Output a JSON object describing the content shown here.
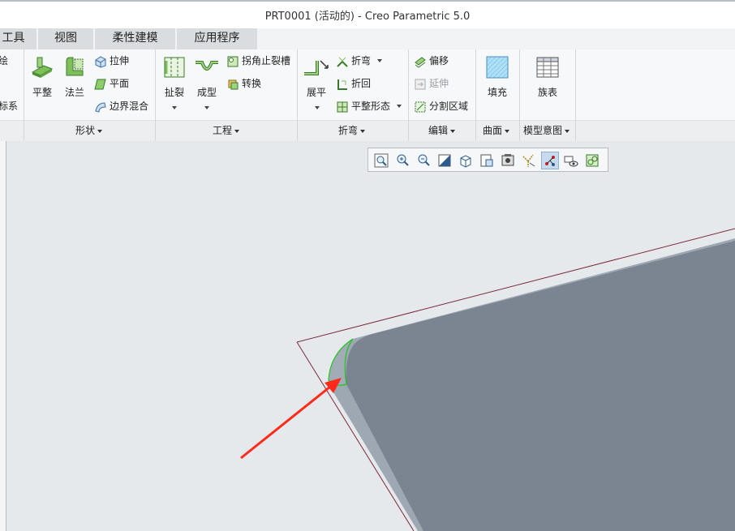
{
  "window": {
    "title": "PRT0001 (活动的) - Creo Parametric 5.0"
  },
  "tabs": [
    {
      "label": "工具"
    },
    {
      "label": "视图"
    },
    {
      "label": "柔性建模"
    },
    {
      "label": "应用程序"
    }
  ],
  "ribbon": {
    "partial_left": {
      "top": "绘",
      "bottom": "坐标系"
    },
    "groups": {
      "shape": {
        "label": "形状",
        "big": [
          {
            "label": "平整",
            "icon": "flat-wall-icon"
          },
          {
            "label": "法兰",
            "icon": "flange-wall-icon"
          }
        ],
        "small": [
          {
            "label": "拉伸",
            "icon": "extrude-icon"
          },
          {
            "label": "平面",
            "icon": "planar-icon"
          },
          {
            "label": "边界混合",
            "icon": "boundary-blend-icon"
          }
        ]
      },
      "engineering": {
        "label": "工程",
        "big": [
          {
            "label": "扯裂",
            "icon": "rip-icon"
          },
          {
            "label": "成型",
            "icon": "form-icon"
          }
        ],
        "small": [
          {
            "label": "拐角止裂槽",
            "icon": "corner-relief-icon"
          },
          {
            "label": "转换",
            "icon": "convert-icon"
          }
        ]
      },
      "bend": {
        "label": "折弯",
        "big": [
          {
            "label": "展平",
            "icon": "unbend-icon"
          }
        ],
        "small": [
          {
            "label": "折弯",
            "icon": "bend-icon"
          },
          {
            "label": "折回",
            "icon": "bend-back-icon"
          },
          {
            "label": "平整形态",
            "icon": "flat-pattern-icon"
          }
        ]
      },
      "editing": {
        "label": "编辑",
        "small": [
          {
            "label": "偏移",
            "icon": "offset-icon"
          },
          {
            "label": "延伸",
            "icon": "extend-icon"
          },
          {
            "label": "分割区域",
            "icon": "split-area-icon"
          }
        ]
      },
      "surfaces": {
        "label": "曲面",
        "big": [
          {
            "label": "填充",
            "icon": "fill-icon"
          }
        ]
      },
      "model_intent": {
        "label": "模型意图",
        "big": [
          {
            "label": "族表",
            "icon": "family-table-icon"
          }
        ]
      }
    }
  },
  "view_toolbar": [
    "refit-icon",
    "zoom-in-icon",
    "zoom-out-icon",
    "repaint-icon",
    "display-style-icon",
    "saved-orientations-icon",
    "view-manager-icon",
    "datum-display-icon",
    "spin-center-icon",
    "annotation-display-icon",
    "appearance-icon"
  ],
  "colors": {
    "part_face": "#7b8591",
    "part_edge": "#9ea8b3",
    "datum_line": "#7a2a3a",
    "highlight": "#22c322",
    "arrow": "#ff2a1a"
  }
}
